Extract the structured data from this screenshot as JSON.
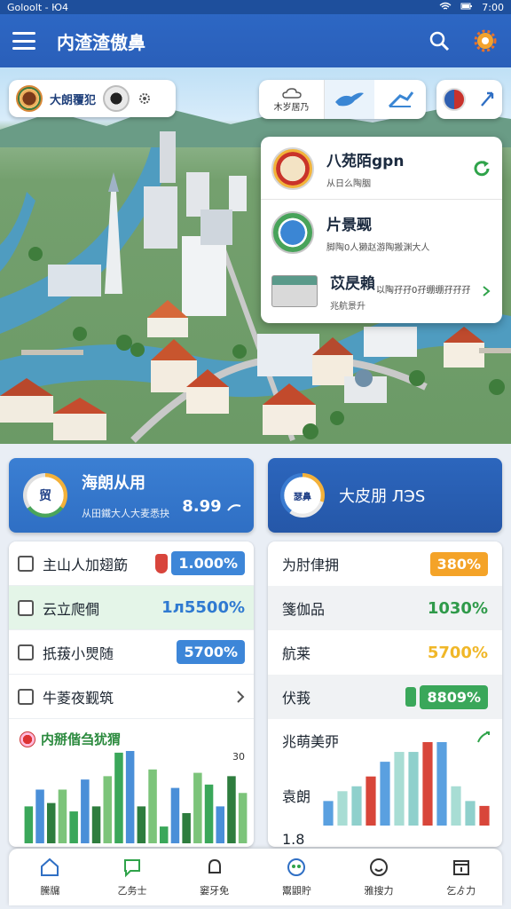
{
  "status_bar": {
    "left": "Goloolt - Ю4",
    "time": "7:00"
  },
  "app_bar": {
    "title": "内渣渣傲鼻"
  },
  "map": {
    "left_chip": {
      "label": "大朗覆犯"
    },
    "mid_chip": {
      "label": "木岁居乃"
    },
    "popover": {
      "items": [
        {
          "title": "八苑陌gpn",
          "subtitle": "从日么陶胭"
        },
        {
          "title": "片景觋",
          "subtitle": "脚陶0人獭赵游陶搬渊大人"
        },
        {
          "title": "苡昃賴",
          "subtitle": "兆航景升",
          "detail": "以陶孖孖0孖绷绷孖孖孖"
        }
      ]
    }
  },
  "card_left": {
    "ring_label": "贸",
    "title": "海朗从用",
    "subtitle": "从田鐵大人大麦悉抉",
    "value": "8.99"
  },
  "card_right": {
    "ring_label": "瑟鼻",
    "title": "大皮朋 ЛЭS"
  },
  "left_list": [
    {
      "label": "主山人加翅筯",
      "value": "1.000%"
    },
    {
      "label": "云立爬僴",
      "value": "1л5500%"
    },
    {
      "label": "扺菝小煛随",
      "value": "5700%"
    },
    {
      "label": "牛菱夜觐筑",
      "value": ""
    }
  ],
  "left_chart": {
    "title": "内掰偕刍犹猬",
    "corner_label": "30",
    "chart_data": {
      "type": "bar",
      "categories": [],
      "series": [
        {
          "values": [
            22,
            32,
            24,
            32,
            19,
            38,
            22,
            40,
            54,
            55,
            22,
            44,
            10,
            33,
            18,
            42,
            35,
            22,
            40,
            30
          ]
        }
      ],
      "colors": [
        "#3aa75a",
        "#4a8fd8",
        "#2e7d3e",
        "#7cc47a"
      ]
    }
  },
  "right_list": [
    {
      "label": "为肘侓拥",
      "value": "380%"
    },
    {
      "label": "箋伽品",
      "value": "1030%"
    },
    {
      "label": "航莱",
      "value": "5700%"
    },
    {
      "label": "伏莪",
      "value": "8809%"
    }
  ],
  "right_chart": {
    "title": "兆萌美丣",
    "side_label": "袁朗",
    "axis_label": "1.8",
    "chart_data": {
      "type": "bar",
      "categories": [],
      "series": [
        {
          "values": [
            10,
            14,
            16,
            20,
            26,
            30,
            30,
            34,
            34,
            16,
            10,
            8
          ]
        }
      ],
      "colors": [
        "#5aa0e0",
        "#a8ddd4",
        "#8fd0cc",
        "#d8463a"
      ]
    }
  },
  "bottom_nav": [
    {
      "label": "騰牖"
    },
    {
      "label": "乙务士"
    },
    {
      "label": "窭牙免"
    },
    {
      "label": "鬻鼰貯"
    },
    {
      "label": "雅搜力"
    },
    {
      "label": "乞ゟ力"
    }
  ]
}
